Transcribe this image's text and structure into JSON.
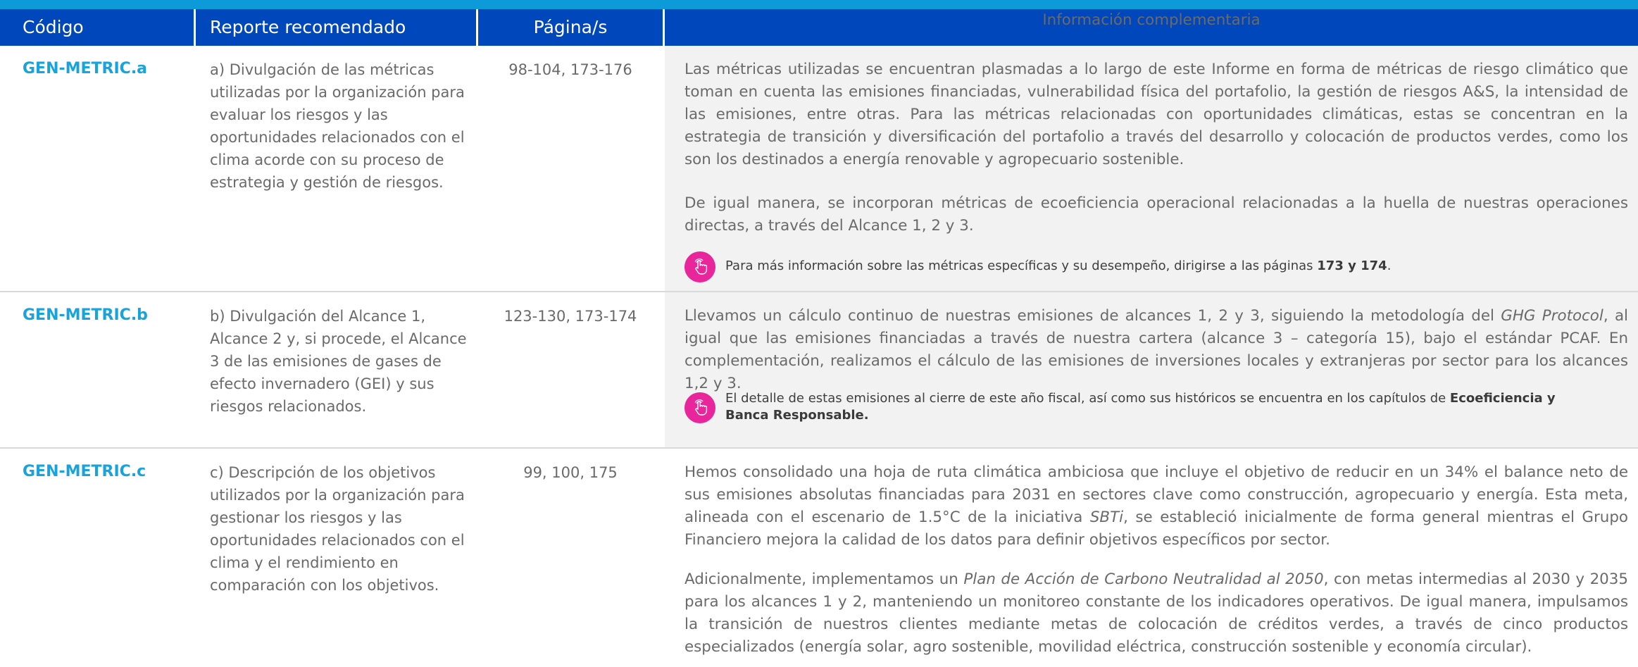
{
  "colors": {
    "header_bg": "#0047bb",
    "top_band": "#0c9ad8",
    "code_text": "#19a3dd",
    "note_icon": "#e9259b",
    "info_bg": "#f2f2f2"
  },
  "header": {
    "codigo": "Código",
    "reporte": "Reporte recomendado",
    "pagina": "Página/s",
    "info": "Información complementaria"
  },
  "rows": [
    {
      "code": "GEN-METRIC.a",
      "report": "a) Divulgación de las métricas utilizadas por la organización para evaluar los riesgos y las oportunidades relacionados con el clima acorde con su proceso de estrategia y gestión de riesgos.",
      "pages": "98-104, 173-176",
      "p1": "Las métricas utilizadas se encuentran plasmadas a lo largo de este Informe en forma de métricas de riesgo climático que toman en cuenta las emisiones financiadas, vulnerabilidad física del portafolio, la gestión de riesgos A&S, la intensidad de las emisiones, entre otras. Para las métricas relacionadas con oportunidades climáticas, estas se concentran en la estrategia de transición y diversificación del portafolio a través del desarrollo y colocación de productos verdes, como los son los destinados a energía renovable y agropecuario sostenible.",
      "p2": "De igual manera, se incorporan métricas de ecoeficiencia operacional relacionadas a la huella de nuestras operaciones directas, a través del Alcance 1, 2 y 3.",
      "note_icon": "hand-pointer-icon",
      "note_text": "Para más información sobre las métricas específicas y su desempeño, dirigirse a las páginas ",
      "note_bold": "173 y 174",
      "note_end": "."
    },
    {
      "code": "GEN-METRIC.b",
      "report": "b) Divulgación del Alcance 1, Alcance 2 y, si procede, el Alcance 3 de las emisiones de gases de efecto invernadero (GEI) y sus riesgos relacionados.",
      "pages": "123-130, 173-174",
      "p1_a": "Llevamos un cálculo continuo de nuestras emisiones de alcances 1, 2 y 3, siguiendo la metodología del ",
      "p1_em": "GHG Protocol",
      "p1_b": ", al igual que las emisiones financiadas a través de nuestra cartera (alcance 3 – categoría 15), bajo el estándar PCAF. En complementación, realizamos el cálculo de las emisiones de inversiones locales y extranjeras por sector para los alcances 1,2 y 3.",
      "note_icon": "hand-pointer-icon",
      "note_text": "El detalle de estas emisiones al cierre de este año fiscal, así como sus históricos se encuentra en los capítulos de ",
      "note_bold": "Ecoeficiencia y Banca Responsable."
    },
    {
      "code": "GEN-METRIC.c",
      "report": "c) Descripción de los objetivos utilizados por la organización para gestionar los riesgos y las oportunidades relacionados con el clima y el rendimiento en comparación con los objetivos.",
      "pages": "99, 100, 175",
      "p1_a": "Hemos consolidado una hoja de ruta climática ambiciosa que incluye el objetivo de reducir en un 34% el balance neto de sus emisiones absolutas financiadas para 2031 en sectores clave como construcción, agropecuario y energía. Esta meta, alineada con el escenario de 1.5°C de la iniciativa ",
      "p1_em": "SBTi",
      "p1_b": ", se estableció inicialmente de forma general mientras el Grupo Financiero mejora la calidad de los datos para definir objetivos específicos por sector.",
      "p2_a": "Adicionalmente, implementamos un ",
      "p2_em": "Plan de Acción de Carbono Neutralidad al 2050",
      "p2_b": ", con metas intermedias al 2030 y 2035 para los alcances 1 y 2, manteniendo un monitoreo constante de los indicadores operativos. De igual manera, impulsamos la transición de nuestros clientes mediante metas de colocación de créditos verdes, a través de cinco productos especializados (energía solar, agro sostenible, movilidad eléctrica, construcción sostenible y economía circular)."
    }
  ]
}
